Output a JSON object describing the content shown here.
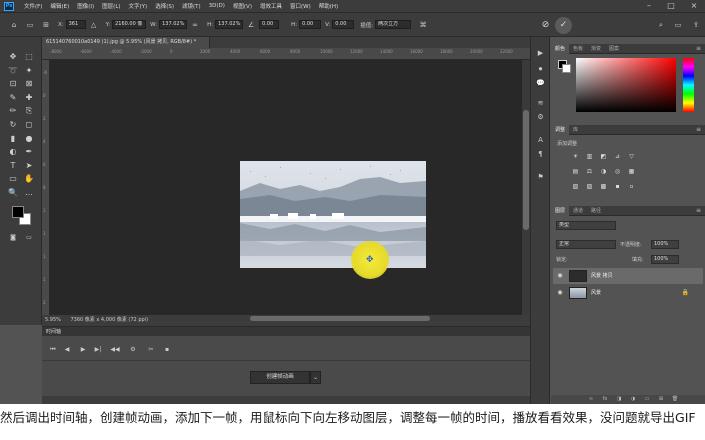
{
  "app": {
    "logo": "Ps",
    "menu": [
      "文件(F)",
      "编辑(E)",
      "图像(I)",
      "图层(L)",
      "文字(Y)",
      "选择(S)",
      "滤镜(T)",
      "3D(D)",
      "视图(V)",
      "增效工具",
      "窗口(W)",
      "帮助(H)"
    ],
    "window_controls": [
      "–",
      "□",
      "×"
    ]
  },
  "options_bar": {
    "x_label": "X:",
    "x_value": "361",
    "y_label": "Y:",
    "y_value": "2160.00 像",
    "w_label": "W:",
    "w_value": "137.02%",
    "h_label": "H:",
    "h_value": "137.02%",
    "angle_value": "0.00",
    "hskew_label": "H:",
    "hskew_value": "0.00",
    "vskew_label": "V:",
    "vskew_value": "0.00",
    "interp_label": "插值:",
    "interp_value": "两次立方"
  },
  "document": {
    "tab_title": "615140760010a0149 (1).jpg @ 5.95% (风景 拷贝, RGB/8#) *",
    "status_zoom": "5.95%",
    "status_info": "7360 像素 x 4,000 像素 (72 ppi)",
    "ruler_top_ticks": [
      "-8000",
      "-6000",
      "-4000",
      "-2000",
      "0",
      "2000",
      "4000",
      "6000",
      "8000",
      "10000",
      "12000",
      "14000",
      "16000",
      "18000",
      "20000",
      "22000"
    ],
    "ruler_left_ticks": [
      "-6",
      "0",
      "2",
      "4",
      "6",
      "8",
      "1",
      "1",
      "1",
      "1",
      "2"
    ]
  },
  "timeline": {
    "title": "时间轴",
    "controls": [
      "⏮",
      "◀",
      "▶",
      "▶|",
      "◀◀",
      "✂",
      "▪"
    ],
    "create_button": "创建帧动画",
    "dropdown_icon": "⌄"
  },
  "toolbar": {
    "tools": [
      "move-tool",
      "marquee-tool",
      "lasso-tool",
      "magic-wand-tool",
      "crop-tool",
      "frame-tool",
      "eyedropper-tool",
      "heal-tool",
      "brush-tool",
      "stamp-tool",
      "history-brush-tool",
      "eraser-tool",
      "gradient-tool",
      "blur-tool",
      "dodge-tool",
      "pen-tool",
      "type-tool",
      "path-select-tool",
      "shape-tool",
      "hand-tool",
      "zoom-tool",
      "more-tool"
    ],
    "glyphs": [
      "✥",
      "⬚",
      "➰",
      "✦",
      "⊡",
      "⊠",
      "✎",
      "✚",
      "✏",
      "⎘",
      "↻",
      "◻",
      "▮",
      "●",
      "◐",
      "✒",
      "T",
      "➤",
      "▭",
      "✋",
      "🔍",
      "…"
    ],
    "foreground_color": "#000000",
    "background_color": "#ffffff"
  },
  "panels": {
    "color_tabs": [
      "颜色",
      "色板",
      "渐变",
      "图案"
    ],
    "adjust_tabs": [
      "调整",
      "库"
    ],
    "adjust_label": "添加调整",
    "adjust_icons_row1": [
      "☀",
      "▥",
      "◩",
      "⊿",
      "▽"
    ],
    "adjust_icons_row2": [
      "▤",
      "⚖",
      "◑",
      "◎",
      "▦"
    ],
    "adjust_icons_row3": [
      "▧",
      "▨",
      "▩",
      "▪",
      "▫"
    ],
    "layers_tabs": [
      "图层",
      "通道",
      "路径"
    ],
    "kind_value": "类型",
    "blend_mode": "正常",
    "opacity_label": "不透明度:",
    "opacity_value": "100%",
    "lock_label": "锁定:",
    "fill_label": "填充:",
    "fill_value": "100%",
    "layers": [
      {
        "name": "风景 拷贝",
        "selected": true
      },
      {
        "name": "风景",
        "selected": false
      }
    ]
  },
  "strip_icons": [
    "▶",
    "⏺",
    "💬",
    "≋",
    "⚙",
    "A",
    "¶",
    "⚑"
  ],
  "subtitle": "然后调出时间轴，创建帧动画，添加下一帧，用鼠标向下向左移动图层，调整每一帧的时间，播放看看效果，没问题就导出GIF"
}
